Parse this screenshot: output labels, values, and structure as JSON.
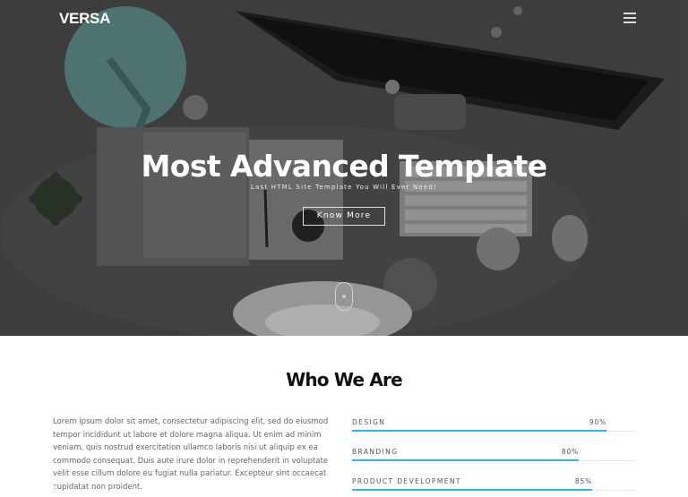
{
  "brand": "VERSA",
  "hero": {
    "title": "Most Advanced Template",
    "subtitle": "Last HTML Site Template You Will Ever Need!",
    "button_label": "Know More"
  },
  "about": {
    "title": "Who We Are",
    "text": "Lorem ipsum dolor sit amet, consectetur adipiscing elit, sed do eiusmod tempor incididunt ut labore et dolore magna aliqua. Ut enim ad minim veniam, quis nostrud exercitation ullamco laboris nisi ut aliquip ex ea commodo consequat. Duis aute irure dolor in reprehenderit in voluptate velit esse cillum dolore eu fugiat nulla pariatur. Excepteur sint occaecat cupidatat non proident."
  },
  "skills": [
    {
      "name": "DESIGN",
      "percent_label": "90%",
      "value": 0.9
    },
    {
      "name": "BRANDING",
      "percent_label": "80%",
      "value": 0.8
    },
    {
      "name": "PRODUCT DEVELOPMENT",
      "percent_label": "85%",
      "value": 0.85
    }
  ],
  "colors": {
    "accent": "#35b5d9",
    "hero_background": "#3b3b3b",
    "title_text": "#111111"
  },
  "icons": {
    "menu": "hamburger-icon",
    "scroll": "mouse-scroll-icon"
  }
}
